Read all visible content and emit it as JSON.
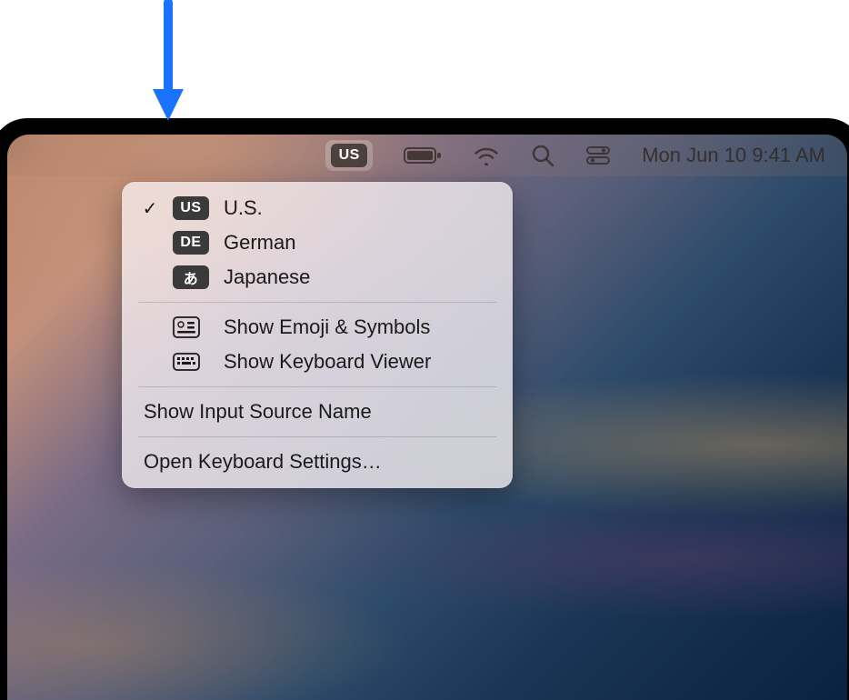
{
  "annotation": {
    "arrow_color": "#1a73ff"
  },
  "menubar": {
    "input_source_badge": "US",
    "datetime": "Mon Jun 10  9:41 AM",
    "icons": [
      "battery-icon",
      "wifi-icon",
      "search-icon",
      "control-center-icon"
    ]
  },
  "input_menu": {
    "sources": [
      {
        "badge": "US",
        "label": "U.S.",
        "checked": true
      },
      {
        "badge": "DE",
        "label": "German",
        "checked": false
      },
      {
        "badge": "あ",
        "label": "Japanese",
        "checked": false
      }
    ],
    "actions": [
      {
        "icon": "emoji-symbols-icon",
        "label": "Show Emoji & Symbols"
      },
      {
        "icon": "keyboard-viewer-icon",
        "label": "Show Keyboard Viewer"
      }
    ],
    "show_source_name": "Show Input Source Name",
    "open_settings": "Open Keyboard Settings…"
  }
}
